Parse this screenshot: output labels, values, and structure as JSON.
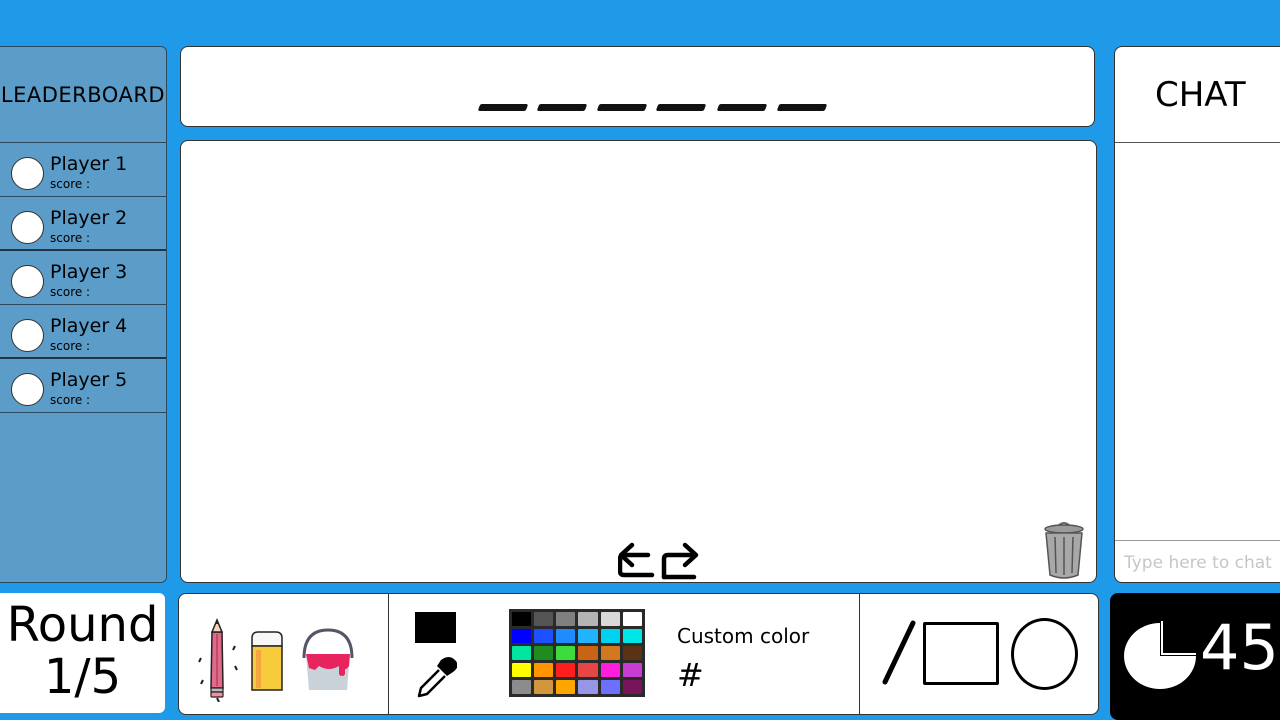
{
  "leaderboard": {
    "title": "LEADERBOARD",
    "players": [
      {
        "name": "Player 1",
        "score_label": "score :"
      },
      {
        "name": "Player 2",
        "score_label": "score :"
      },
      {
        "name": "Player 3",
        "score_label": "score :"
      },
      {
        "name": "Player 4",
        "score_label": "score :"
      },
      {
        "name": "Player 5",
        "score_label": "score :"
      }
    ]
  },
  "word": {
    "hidden_letters": 6
  },
  "canvas": {
    "undo_icon": "undo-arrow-icon",
    "redo_icon": "redo-arrow-icon",
    "clear_icon": "trash-icon"
  },
  "chat": {
    "title": "CHAT",
    "placeholder": "Type here to chat"
  },
  "round": {
    "label": "Round",
    "value": "1/5"
  },
  "toolbar": {
    "tools": [
      "pencil-icon",
      "eraser-icon",
      "paint-bucket-icon"
    ],
    "current_color": "#000000",
    "eyedropper_icon": "eyedropper-icon",
    "palette": [
      "#000000",
      "#555555",
      "#808080",
      "#b5b5b5",
      "#d9d9d9",
      "#ffffff",
      "#0000ff",
      "#1e50ff",
      "#1e8cff",
      "#20b4ff",
      "#00d2f0",
      "#00e6e6",
      "#00e6a0",
      "#1e8c1e",
      "#3cdc3c",
      "#c86414",
      "#d2781e",
      "#5a3214",
      "#ffff00",
      "#ff9600",
      "#ff1e1e",
      "#e64646",
      "#ff1edc",
      "#c83cd2",
      "#8c8c8c",
      "#d2963c",
      "#ffa500",
      "#9696e6",
      "#6e6eff",
      "#78145a"
    ],
    "custom_color_label": "Custom color",
    "hash": "#",
    "shapes": [
      "line-icon",
      "rectangle-icon",
      "circle-icon"
    ]
  },
  "timer": {
    "value": "45",
    "icon": "clock-icon"
  }
}
